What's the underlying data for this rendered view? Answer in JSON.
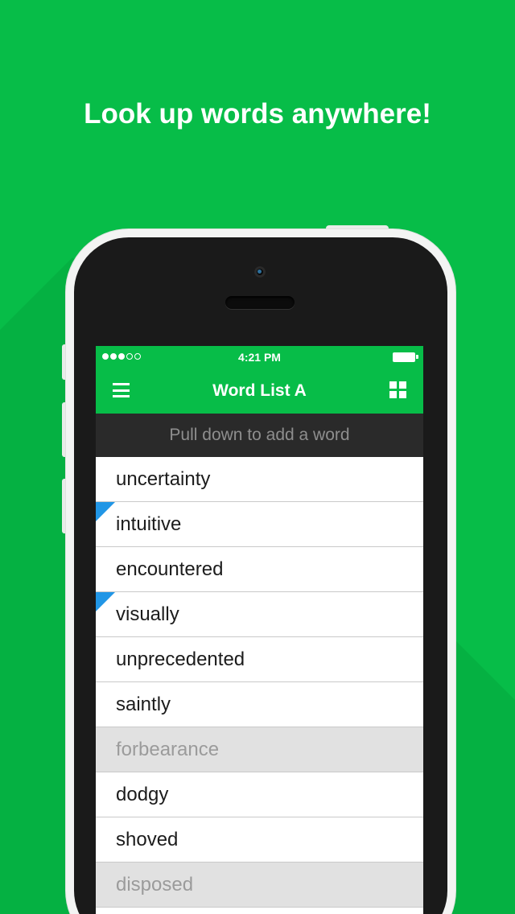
{
  "headline": "Look up words anywhere!",
  "status_bar": {
    "time": "4:21 PM",
    "signal_dots": [
      true,
      true,
      true,
      false,
      false
    ],
    "battery": "full"
  },
  "nav": {
    "title": "Word List A",
    "left_icon": "menu-icon",
    "right_icon": "grid-icon"
  },
  "pull_hint": "Pull down to add a word",
  "words": [
    {
      "text": "uncertainty",
      "flagged": false,
      "dimmed": false
    },
    {
      "text": "intuitive",
      "flagged": true,
      "dimmed": false
    },
    {
      "text": "encountered",
      "flagged": false,
      "dimmed": false
    },
    {
      "text": "visually",
      "flagged": true,
      "dimmed": false
    },
    {
      "text": "unprecedented",
      "flagged": false,
      "dimmed": false
    },
    {
      "text": "saintly",
      "flagged": false,
      "dimmed": false
    },
    {
      "text": "forbearance",
      "flagged": false,
      "dimmed": true
    },
    {
      "text": "dodgy",
      "flagged": false,
      "dimmed": false
    },
    {
      "text": "shoved",
      "flagged": false,
      "dimmed": false
    },
    {
      "text": "disposed",
      "flagged": false,
      "dimmed": true
    },
    {
      "text": "",
      "flagged": false,
      "dimmed": false
    }
  ],
  "colors": {
    "brand_green": "#07bd48",
    "flag_blue": "#2196e6",
    "dimmed_row": "#e1e1e1"
  }
}
